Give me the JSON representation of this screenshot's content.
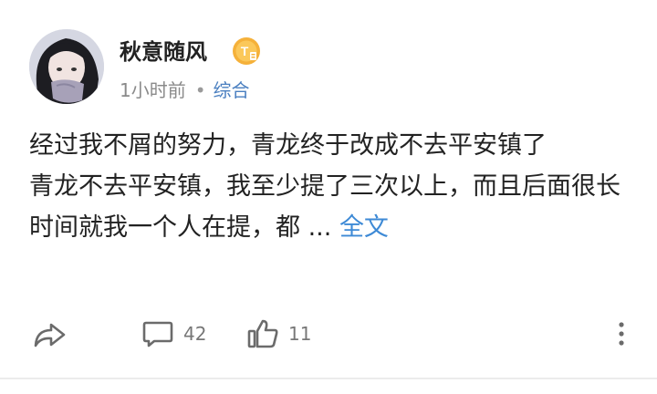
{
  "post": {
    "username": "秋意随风",
    "badge_icon": "t-badge-icon",
    "time": "1小时前",
    "separator": "•",
    "topic": "综合",
    "paragraphs": [
      "经过我不屑的努力，青龙终于改成不去平安镇了",
      "青龙不去平安镇，我至少提了三次以上，而且后面很长时间就我一个人在提，都 ..."
    ],
    "more_label": "全文"
  },
  "actions": {
    "share_icon": "share-icon",
    "comment_icon": "comment-icon",
    "comment_count": "42",
    "like_icon": "thumbs-up-icon",
    "like_count": "11",
    "more_icon": "more-vertical-icon"
  },
  "colors": {
    "badge": "#f5b13a",
    "link": "#3e8ad6",
    "topic": "#4a7fc0",
    "muted": "#8a8a8a"
  }
}
